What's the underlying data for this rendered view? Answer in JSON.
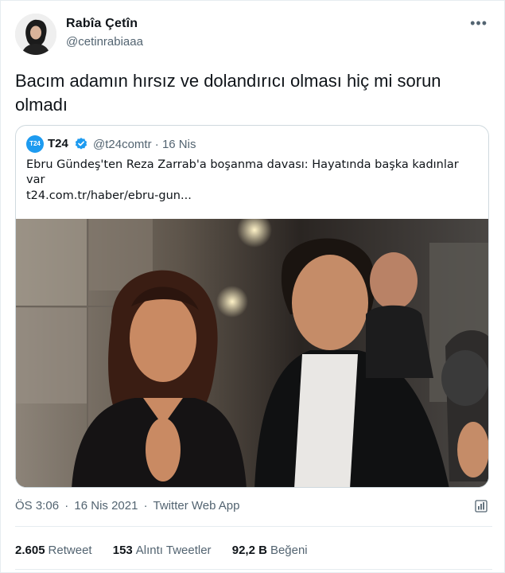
{
  "user": {
    "display_name": "Rabîa Çetîn",
    "handle": "@cetinrabiaaa",
    "avatar_icon": "person-avatar"
  },
  "tweet": {
    "text": "Bacım adamın hırsız ve dolandırıcı olması hiç mi sorun olmadı"
  },
  "quoted": {
    "logo_text": "T24",
    "name": "T24",
    "handle": "@t24comtr",
    "separator": "·",
    "date": "16 Nis",
    "text": "Ebru Gündeş'ten Reza Zarrab'a boşanma davası: Hayatında başka kadınlar var",
    "link": "t24.com.tr/haber/ebru-gun...",
    "verified_icon": "verified-badge-icon"
  },
  "meta": {
    "time": "ÖS 3:06",
    "separator": "·",
    "date": "16 Nis 2021",
    "source": "Twitter Web App"
  },
  "stats": [
    {
      "value": "2.605",
      "label": "Retweet"
    },
    {
      "value": "153",
      "label": "Alıntı Tweetler"
    },
    {
      "value": "92,2 B",
      "label": "Beğeni"
    }
  ],
  "colors": {
    "accent": "#1d9bf0",
    "secondary_text": "#536471",
    "primary_text": "#0f1419",
    "border": "#cfd9de"
  }
}
